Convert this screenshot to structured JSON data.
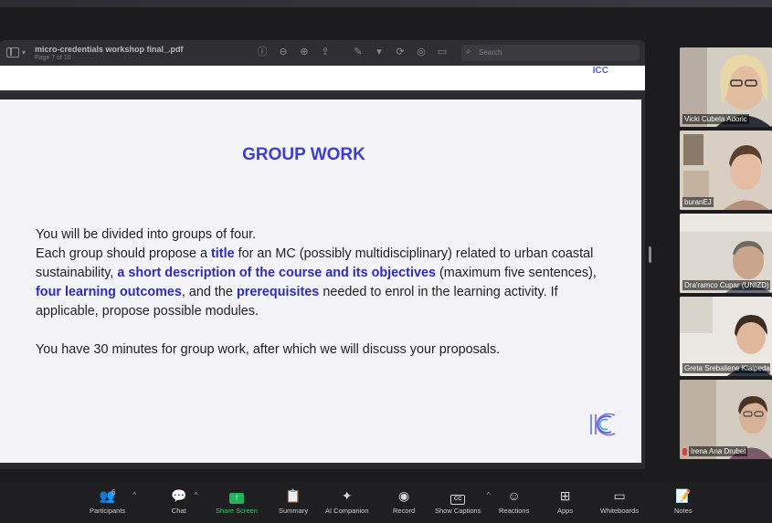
{
  "viewer": {
    "doc_title": "micro-credentials workshop final_.pdf",
    "page_info": "Page 7 of 10",
    "search_placeholder": "Search"
  },
  "slide": {
    "title": "GROUP WORK",
    "p1_s1": "You will be divided into groups of four.",
    "p1_a": "Each group should propose a ",
    "p1_title": "title",
    "p1_b": " for an MC (possibly multidisciplinary) related to urban coastal sustainability, ",
    "p1_desc": "a short description of the course and its objectives",
    "p1_c": " (maximum five sentences), ",
    "p1_outcomes": "four learning outcomes",
    "p1_d": ", and the ",
    "p1_prereq": "prerequisites",
    "p1_e": " needed to enrol in the learning activity. If applicable, propose possible modules.",
    "p2": "You have 30 minutes for group work, after which we will discuss your proposals."
  },
  "gallery": {
    "participants": [
      {
        "name": "Vicki Cubela Adoric",
        "active": false,
        "muted": false
      },
      {
        "name": "buranEJ",
        "active": false,
        "muted": false
      },
      {
        "name": "Dra'ramco Cupar (UNIZD)",
        "active": true,
        "muted": false
      },
      {
        "name": "Greta Srebaliene Klaipeda",
        "active": false,
        "muted": false
      },
      {
        "name": "Irena Ana Drubet",
        "active": false,
        "muted": true
      }
    ]
  },
  "controls": {
    "participants_label": "Participants",
    "participants_count": "6",
    "chat_label": "Chat",
    "share_label": "Share Screen",
    "summary_label": "Summary",
    "ai_label": "AI Companion",
    "record_label": "Record",
    "captions_label": "Show Captions",
    "reactions_label": "Reactions",
    "apps_label": "Apps",
    "whiteboards_label": "Whiteboards",
    "notes_label": "Notes"
  },
  "colors": {
    "slide_accent": "#3b3fcb",
    "share_green": "#2fcf6b",
    "active_speaker": "#e8d84a"
  }
}
